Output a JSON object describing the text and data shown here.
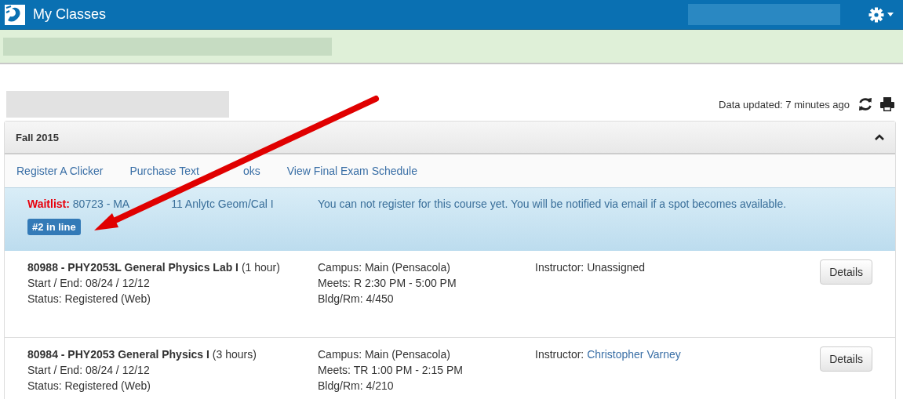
{
  "app": {
    "title": "My Classes"
  },
  "page": {
    "updated": "Data updated: 7 minutes ago"
  },
  "term": {
    "title": "Fall 2015",
    "expanded": true,
    "links": [
      {
        "parts": [
          "Register A Clicker"
        ]
      },
      {
        "parts": [
          "Purchase Text",
          "oks"
        ]
      },
      {
        "parts": [
          "View Final Exam Schedule"
        ]
      }
    ],
    "waitlist": {
      "label": "Waitlist:",
      "course_parts": [
        "80723 - MA",
        "11 Anlytc Geom/Cal I"
      ],
      "message": "You can not register for this course yet. You will be notified via email if a spot becomes available.",
      "position": "#2 in line"
    },
    "courses": [
      {
        "title": "**80988 - PHY2053L General Physics Lab I** (1 hour)",
        "dates": "Start / End: 08/24 / 12/12",
        "status": "Status: Registered (Web)",
        "campus": "Campus: Main (Pensacola)",
        "meets": "Meets: R 2:30 PM - 5:00 PM",
        "room": "Bldg/Rm: 4/450",
        "instructor_label": "Instructor:",
        "instructor": "Unassigned",
        "instructor_linked": false,
        "button": "Details"
      },
      {
        "title": "**80984 - PHY2053 General Physics I** (3 hours)",
        "dates": "Start / End: 08/24 / 12/12",
        "status": "Status: Registered (Web)",
        "campus": "Campus: Main (Pensacola)",
        "meets": "Meets: TR 1:00 PM - 2:15 PM",
        "room": "Bldg/Rm: 4/210",
        "instructor_label": "Instructor:",
        "instructor": "Christopher Varney",
        "instructor_linked": true,
        "button": "Details"
      }
    ]
  }
}
